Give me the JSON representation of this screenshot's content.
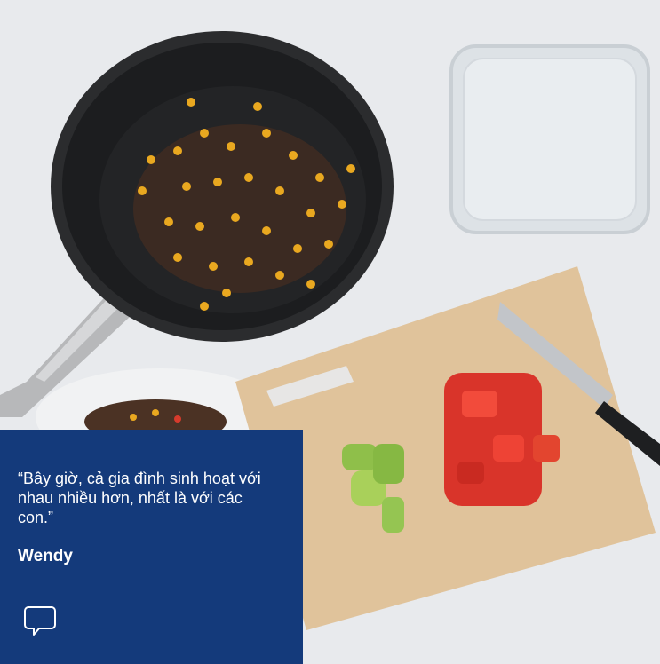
{
  "hero": {
    "image_icon": "photo-cooking-scene",
    "colors": {
      "card_background": "#143a7b",
      "card_text": "#ffffff"
    }
  },
  "testimonial": {
    "quote": "“Bây giờ, cả gia đình sinh hoạt với nhau nhiều hơn, nhất là với các con.”",
    "author": "Wendy",
    "icon": "speech-bubble-icon"
  }
}
